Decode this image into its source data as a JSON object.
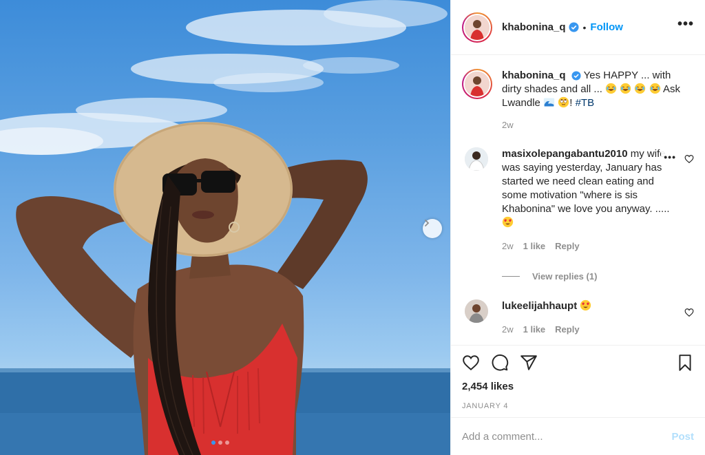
{
  "post": {
    "username": "khabonina_q",
    "verified": true,
    "follow_label": "Follow",
    "bullet": "•",
    "more_label": "•••",
    "carousel": {
      "total_slides": 3,
      "active_slide": 1
    }
  },
  "caption": {
    "username": "khabonina_q",
    "text_part1": "Yes HAPPY ... with dirty shades and all ...",
    "text_part2": "Ask Lwandle",
    "text_part3": "!",
    "hashtag": "#TB",
    "timestamp": "2w"
  },
  "comments": [
    {
      "username": "masixolepangabantu2010",
      "text": "my wife was saying yesterday, January has started we need clean eating and some motivation \"where is sis Khabonina\" we love you anyway. .....",
      "time": "2w",
      "likes": "1 like",
      "reply_label": "Reply",
      "more_label": "•••",
      "view_replies": "View replies (1)"
    },
    {
      "username": "lukeelijahhaupt",
      "text": "",
      "time": "2w",
      "likes": "1 like",
      "reply_label": "Reply"
    }
  ],
  "actions": {
    "likes": "2,454 likes",
    "date": "JANUARY 4"
  },
  "add_comment": {
    "placeholder": "Add a comment...",
    "post_label": "Post"
  },
  "colors": {
    "link_blue": "#0095f6",
    "post_disabled": "#b2dffc",
    "hashtag": "#00376b",
    "muted": "#8e8e8e",
    "swimsuit_red": "#d8302f"
  },
  "icons": [
    "verified-badge-icon",
    "chevron-right-icon",
    "heart-icon",
    "comment-icon",
    "share-icon",
    "bookmark-icon",
    "joy-emoji-icon",
    "wave-emoji-icon",
    "eyeroll-emoji-icon",
    "heart-eyes-emoji-icon"
  ]
}
